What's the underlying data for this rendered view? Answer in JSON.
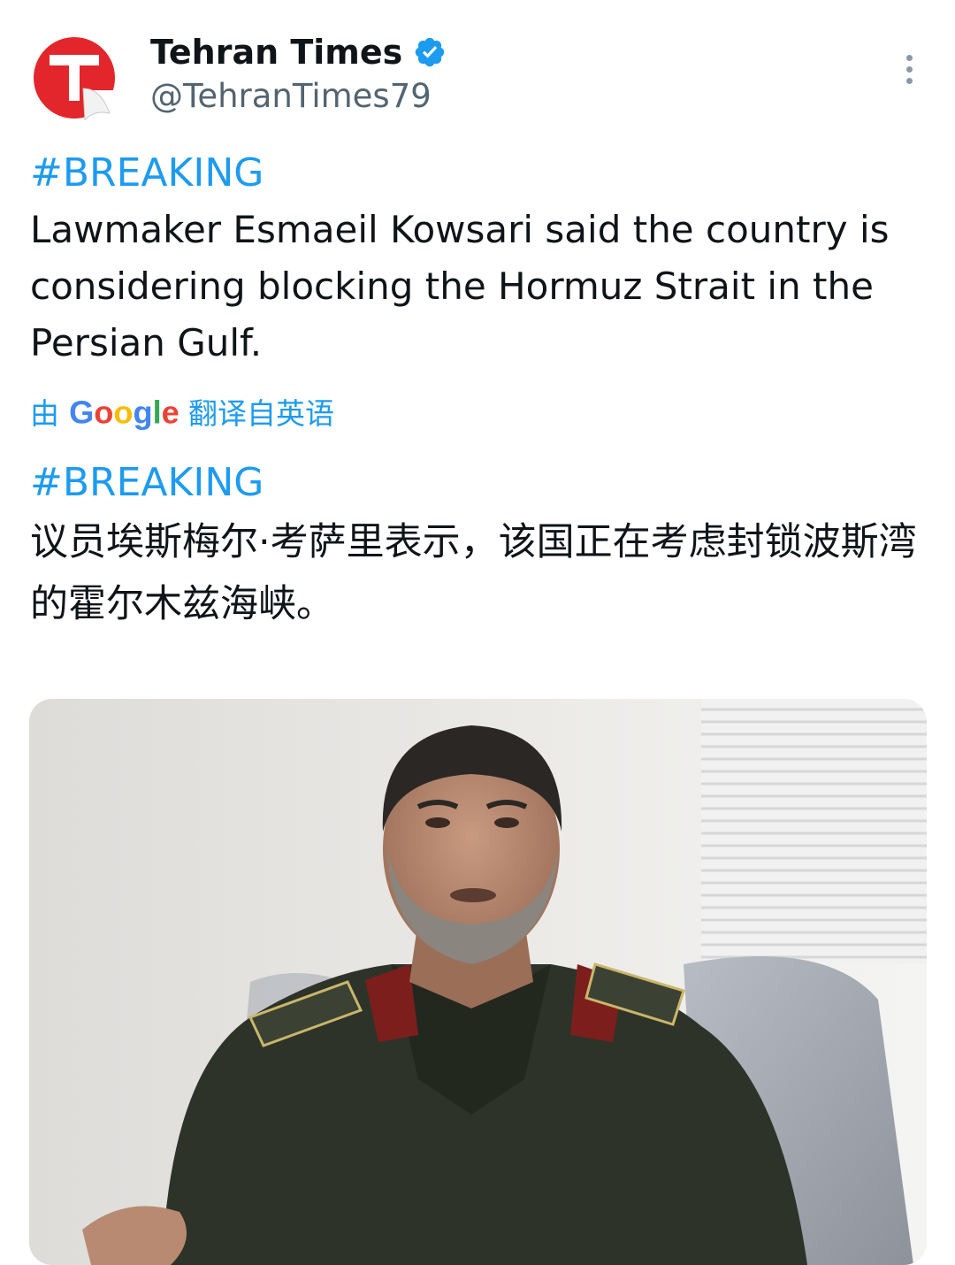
{
  "author": {
    "display_name": "Tehran Times",
    "handle": "@TehranTimes79",
    "avatar_icon": "tehran-times-logo-icon",
    "verified_icon": "verified-badge-icon",
    "verified_color": "#1d9bf0"
  },
  "menu": {
    "icon": "more-options-icon"
  },
  "tweet": {
    "hashtag": "#BREAKING",
    "text": "Lawmaker Esmaeil Kowsari said the country is considering blocking the Hormuz Strait in the Persian Gulf."
  },
  "translation": {
    "prefix": "由",
    "provider": "Google",
    "suffix": "翻译自英语",
    "hashtag": "#BREAKING",
    "text": "议员埃斯梅尔·考萨里表示，该国正在考虑封锁波斯湾的霍尔木兹海峡。"
  },
  "media": {
    "icon": "photo-of-man-in-uniform"
  },
  "colors": {
    "link": "#1d9bf0",
    "text": "#0f1419",
    "secondary": "#536471",
    "brand_red": "#e3262b"
  }
}
